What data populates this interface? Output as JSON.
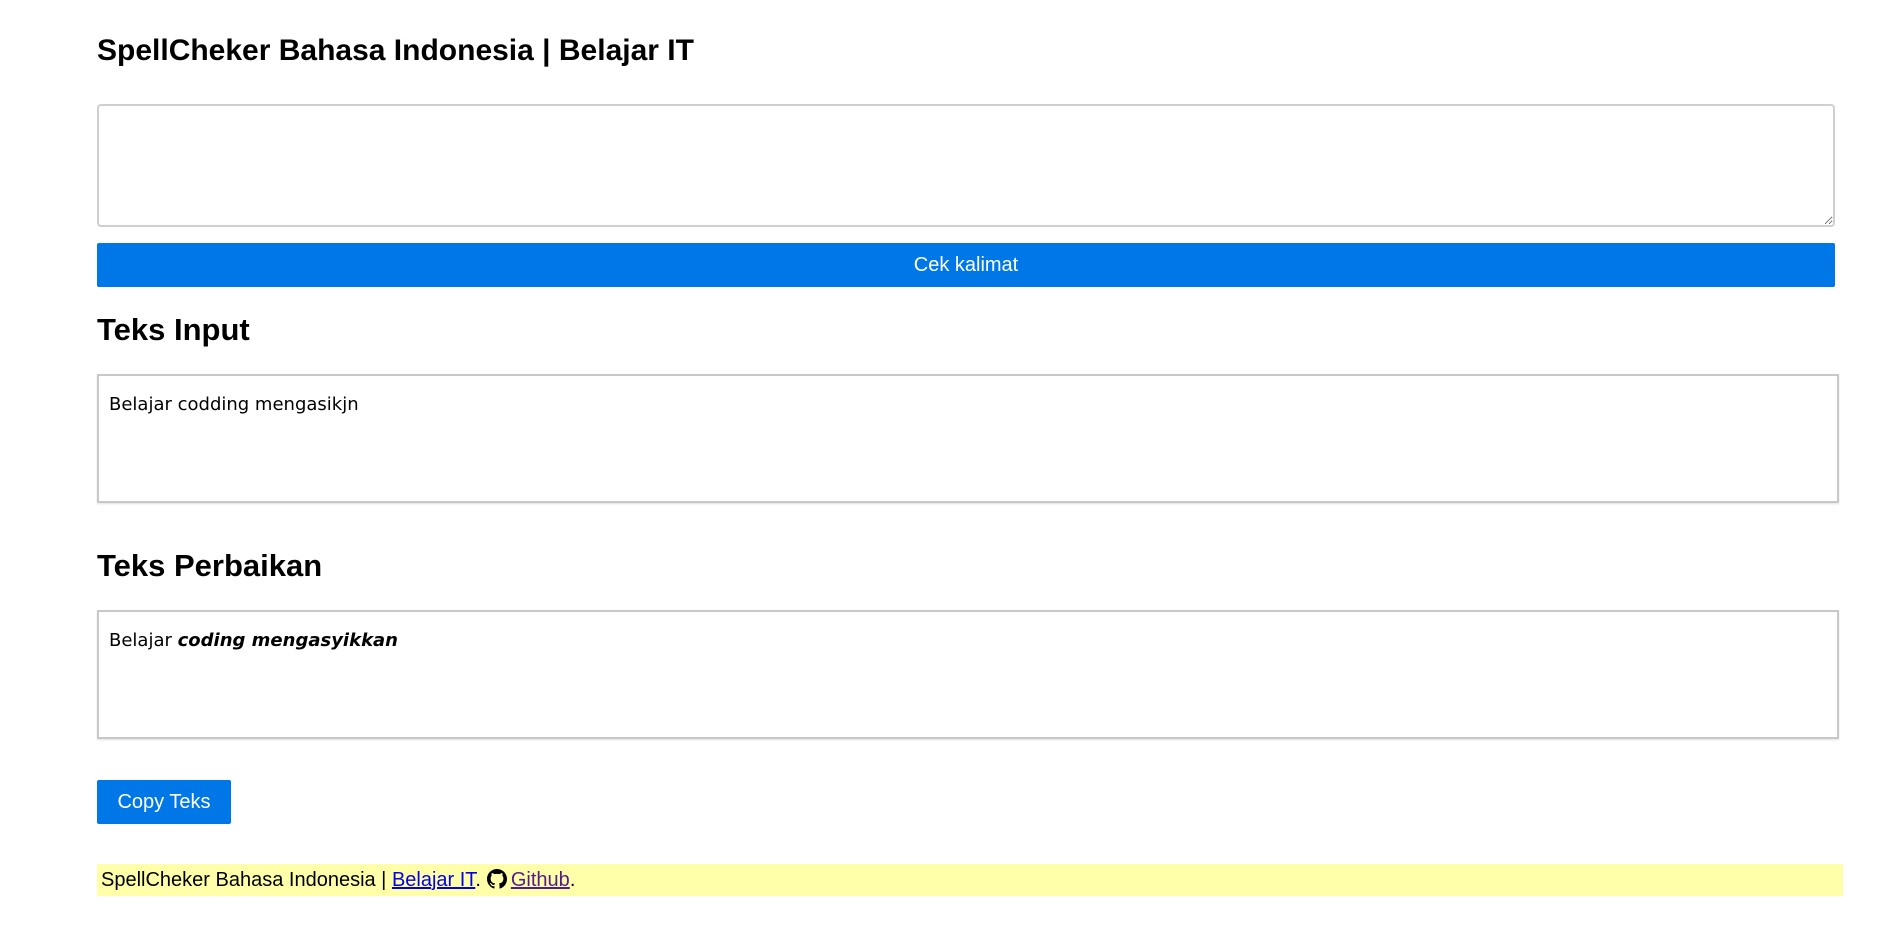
{
  "app": {
    "title": "SpellCheker Bahasa Indonesia | Belajar IT"
  },
  "input_area": {
    "value": ""
  },
  "check_button": {
    "label": "Cek kalimat"
  },
  "input_section": {
    "heading": "Teks Input",
    "text": "Belajar codding mengasikjn"
  },
  "fix_section": {
    "heading": "Teks Perbaikan",
    "plain_text": "Belajar ",
    "corrected_text": "coding mengasyikkan"
  },
  "copy_button": {
    "label": "Copy Teks"
  },
  "footer": {
    "prefix": "SpellCheker Bahasa Indonesia | ",
    "belajar_link": "Belajar IT",
    "separator": ".",
    "github_icon": "github-icon",
    "github_link": "Github",
    "suffix": "."
  },
  "colors": {
    "accent": "#0077e6",
    "footer_background": "#ffffa9",
    "link": "#0000ee",
    "visited_link": "#551a8b"
  }
}
